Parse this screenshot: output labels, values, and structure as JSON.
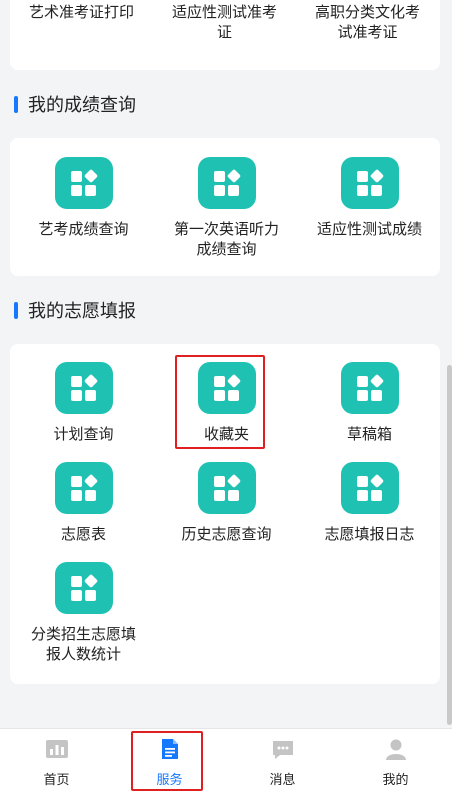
{
  "top_items": [
    {
      "label": "艺术准考证打印"
    },
    {
      "label": "适应性测试准考证"
    },
    {
      "label": "高职分类文化考试准考证"
    }
  ],
  "score_section": {
    "title": "我的成绩查询",
    "items": [
      {
        "label": "艺考成绩查询",
        "icon": "grid-icon"
      },
      {
        "label": "第一次英语听力成绩查询",
        "icon": "grid-icon"
      },
      {
        "label": "适应性测试成绩",
        "icon": "grid-icon"
      }
    ]
  },
  "volunteer_section": {
    "title": "我的志愿填报",
    "items": [
      {
        "label": "计划查询",
        "icon": "grid-icon"
      },
      {
        "label": "收藏夹",
        "icon": "grid-icon"
      },
      {
        "label": "草稿箱",
        "icon": "grid-icon"
      },
      {
        "label": "志愿表",
        "icon": "grid-icon"
      },
      {
        "label": "历史志愿查询",
        "icon": "grid-icon"
      },
      {
        "label": "志愿填报日志",
        "icon": "grid-icon"
      },
      {
        "label": "分类招生志愿填报人数统计",
        "icon": "grid-icon"
      }
    ]
  },
  "tabbar": {
    "items": [
      {
        "label": "首页",
        "icon": "home-chart-icon"
      },
      {
        "label": "服务",
        "icon": "document-icon",
        "active": true
      },
      {
        "label": "消息",
        "icon": "message-icon"
      },
      {
        "label": "我的",
        "icon": "user-icon"
      }
    ]
  },
  "colors": {
    "accent": "#1677ff",
    "tile": "#1fc1b3",
    "highlight": "#e02020",
    "inactive_icon": "#c4c4c4"
  }
}
